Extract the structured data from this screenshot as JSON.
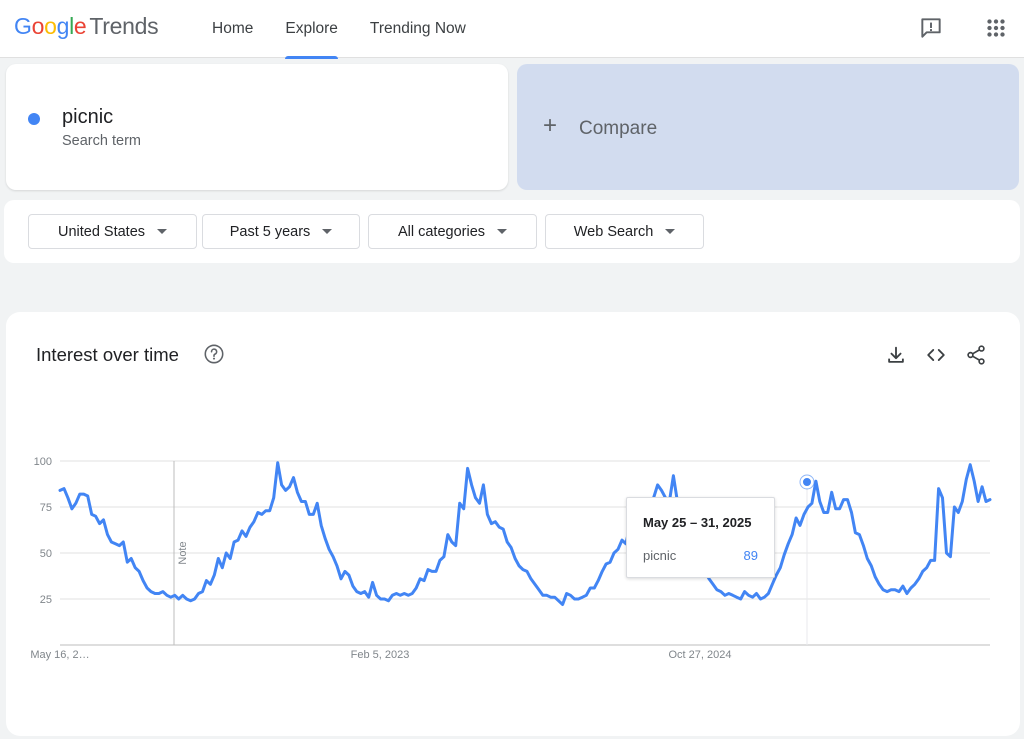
{
  "header": {
    "logo": {
      "g": "G",
      "o1": "o",
      "o2": "o",
      "g2": "g",
      "l": "l",
      "e": "e",
      "product": "Trends"
    },
    "nav": [
      "Home",
      "Explore",
      "Trending Now"
    ],
    "active_nav": "Explore",
    "icons": [
      "feedback-icon",
      "apps-icon"
    ]
  },
  "search_term": {
    "name": "picnic",
    "type": "Search term",
    "color": "#4285f4"
  },
  "compare": {
    "plus": "+",
    "label": "Compare"
  },
  "filters": [
    "United States",
    "Past 5 years",
    "All categories",
    "Web Search"
  ],
  "chart_card": {
    "title": "Interest over time",
    "icons": [
      "help-icon",
      "download-icon",
      "embed-icon",
      "share-icon"
    ],
    "note_label": "Note"
  },
  "tooltip": {
    "date": "May 25 – 31, 2025",
    "term": "picnic",
    "value": "89"
  },
  "chart_data": {
    "type": "line",
    "title": "Interest over time",
    "xlabel": "",
    "ylabel": "",
    "ylim": [
      0,
      100
    ],
    "yticks": [
      25,
      50,
      75,
      100
    ],
    "xtick_labels": [
      "May 16, 2…",
      "Feb 5, 2023",
      "Oct 27, 2024"
    ],
    "grid": true,
    "series": [
      {
        "name": "picnic",
        "color": "#4285f4",
        "values": [
          84,
          85,
          80,
          74,
          77,
          82,
          82,
          81,
          71,
          70,
          66,
          68,
          60,
          56,
          55,
          54,
          56,
          45,
          47,
          42,
          40,
          35,
          31,
          29,
          28,
          28,
          29,
          27,
          26,
          27,
          25,
          27,
          25,
          24,
          25,
          28,
          29,
          35,
          33,
          38,
          47,
          42,
          50,
          47,
          56,
          57,
          62,
          59,
          64,
          67,
          72,
          71,
          73,
          73,
          80,
          99,
          87,
          84,
          86,
          91,
          83,
          78,
          78,
          71,
          71,
          77,
          65,
          58,
          52,
          48,
          43,
          36,
          40,
          38,
          32,
          29,
          28,
          29,
          26,
          34,
          27,
          25,
          25,
          24,
          27,
          28,
          27,
          28,
          27,
          28,
          31,
          36,
          35,
          41,
          40,
          40,
          46,
          48,
          60,
          56,
          54,
          77,
          74,
          96,
          87,
          80,
          77,
          87,
          71,
          66,
          67,
          64,
          63,
          56,
          53,
          47,
          43,
          41,
          40,
          36,
          33,
          30,
          27,
          27,
          26,
          26,
          24,
          22,
          28,
          27,
          25,
          25,
          26,
          27,
          31,
          31,
          35,
          40,
          44,
          45,
          50,
          52,
          57,
          55,
          65,
          63,
          69,
          72,
          77,
          72,
          80,
          87,
          84,
          80,
          78,
          92,
          78,
          70,
          66,
          60,
          53,
          48,
          42,
          40,
          36,
          33,
          30,
          29,
          27,
          28,
          27,
          26,
          25,
          29,
          27,
          26,
          28,
          25,
          26,
          28,
          33,
          38,
          42,
          49,
          55,
          60,
          69,
          65,
          71,
          75,
          77,
          89,
          78,
          72,
          72,
          83,
          74,
          74,
          79,
          79,
          72,
          61,
          60,
          54,
          47,
          43,
          37,
          33,
          30,
          29,
          30,
          30,
          29,
          32,
          28,
          31,
          33,
          36,
          40,
          42,
          46,
          46,
          85,
          80,
          50,
          48,
          75,
          72,
          78,
          90,
          98,
          89,
          78,
          86,
          78,
          79
        ]
      }
    ]
  }
}
